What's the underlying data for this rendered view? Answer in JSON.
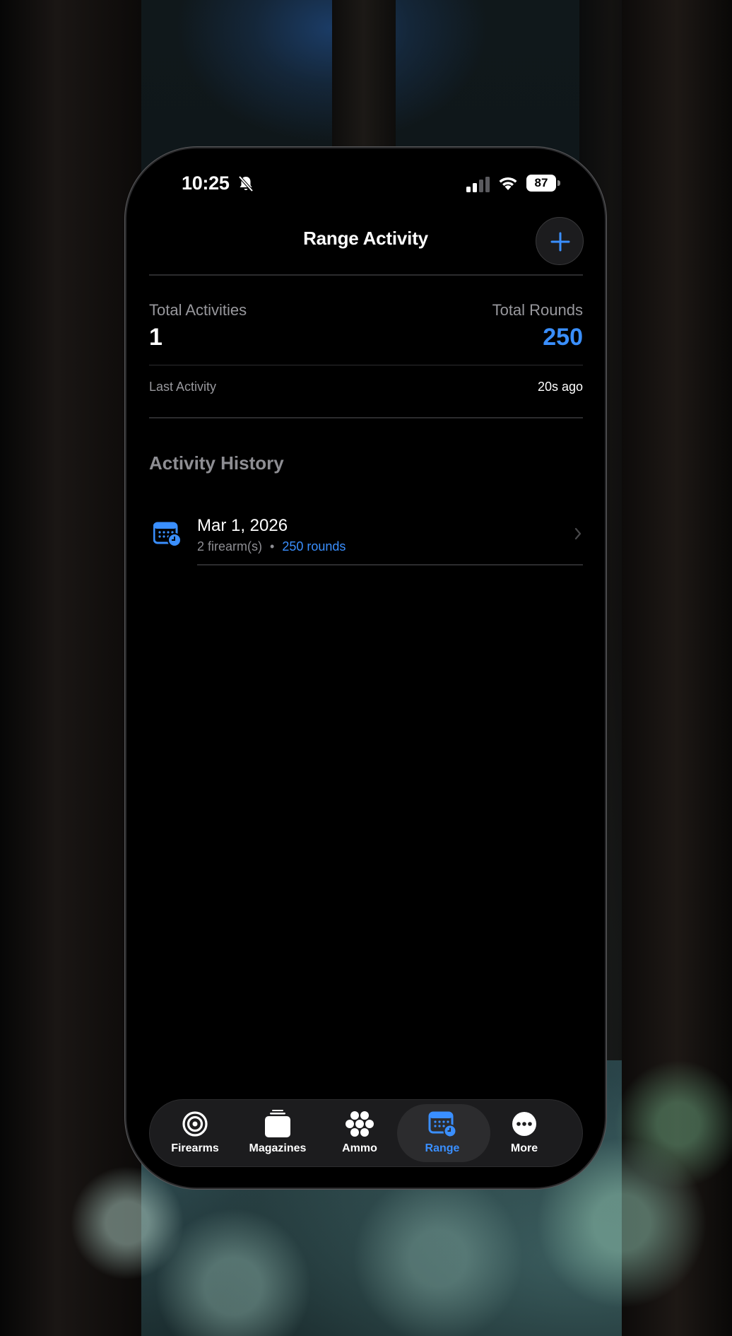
{
  "status_bar": {
    "time": "10:25",
    "battery": "87"
  },
  "header": {
    "title": "Range Activity",
    "add_icon": "plus-icon"
  },
  "summary": {
    "total_activities_label": "Total Activities",
    "total_activities_value": "1",
    "total_rounds_label": "Total Rounds",
    "total_rounds_value": "250",
    "last_activity_label": "Last Activity",
    "last_activity_value": "20s ago"
  },
  "history": {
    "title": "Activity History",
    "items": [
      {
        "date": "Mar 1, 2026",
        "firearms": "2 firearm(s)",
        "separator": "•",
        "rounds": "250 rounds",
        "icon": "calendar-clock-icon"
      }
    ]
  },
  "tabs": [
    {
      "label": "Firearms",
      "icon": "target-icon"
    },
    {
      "label": "Magazines",
      "icon": "magazine-icon"
    },
    {
      "label": "Ammo",
      "icon": "ammo-icon"
    },
    {
      "label": "Range",
      "icon": "calendar-clock-icon",
      "active": true
    },
    {
      "label": "More",
      "icon": "more-icon"
    }
  ],
  "colors": {
    "accent": "#3a8fff",
    "background": "#000000",
    "secondary_text": "#98989d"
  }
}
